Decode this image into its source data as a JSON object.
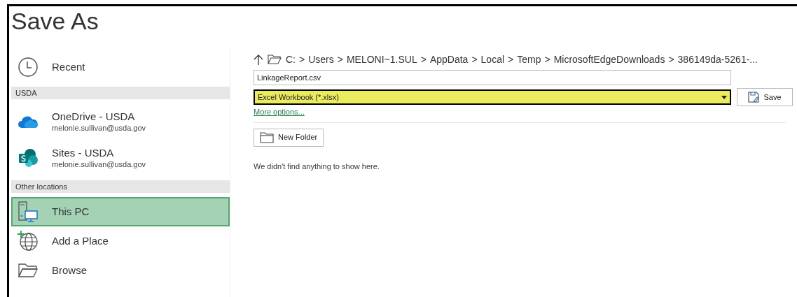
{
  "window": {
    "title": "Save As"
  },
  "sidebar": {
    "items": [
      {
        "kind": "location",
        "label": "Recent",
        "selected": false
      },
      {
        "kind": "header",
        "label": "USDA"
      },
      {
        "kind": "account",
        "label": "OneDrive - USDA",
        "sublabel": "melonie.sullivan@usda.gov",
        "selected": false
      },
      {
        "kind": "account",
        "label": "Sites - USDA",
        "sublabel": "melonie.sullivan@usda.gov",
        "selected": false
      },
      {
        "kind": "header",
        "label": "Other locations"
      },
      {
        "kind": "location",
        "label": "This PC",
        "selected": true
      },
      {
        "kind": "location",
        "label": "Add a Place",
        "selected": false
      },
      {
        "kind": "location",
        "label": "Browse",
        "selected": false
      }
    ]
  },
  "path": {
    "segments": [
      "C:",
      "Users",
      "MELONI~1.SUL",
      "AppData",
      "Local",
      "Temp",
      "MicrosoftEdgeDownloads",
      "386149da-5261-..."
    ],
    "separator": ">"
  },
  "file_name": {
    "value": "LinkageReport.csv"
  },
  "file_type": {
    "value": "Excel Workbook (*.xlsx)",
    "highlighted": true
  },
  "save_button": {
    "label": "Save"
  },
  "more_options": {
    "label": "More options..."
  },
  "new_folder_button": {
    "label": "New Folder"
  },
  "empty_message": "We didn't find anything to show here."
}
